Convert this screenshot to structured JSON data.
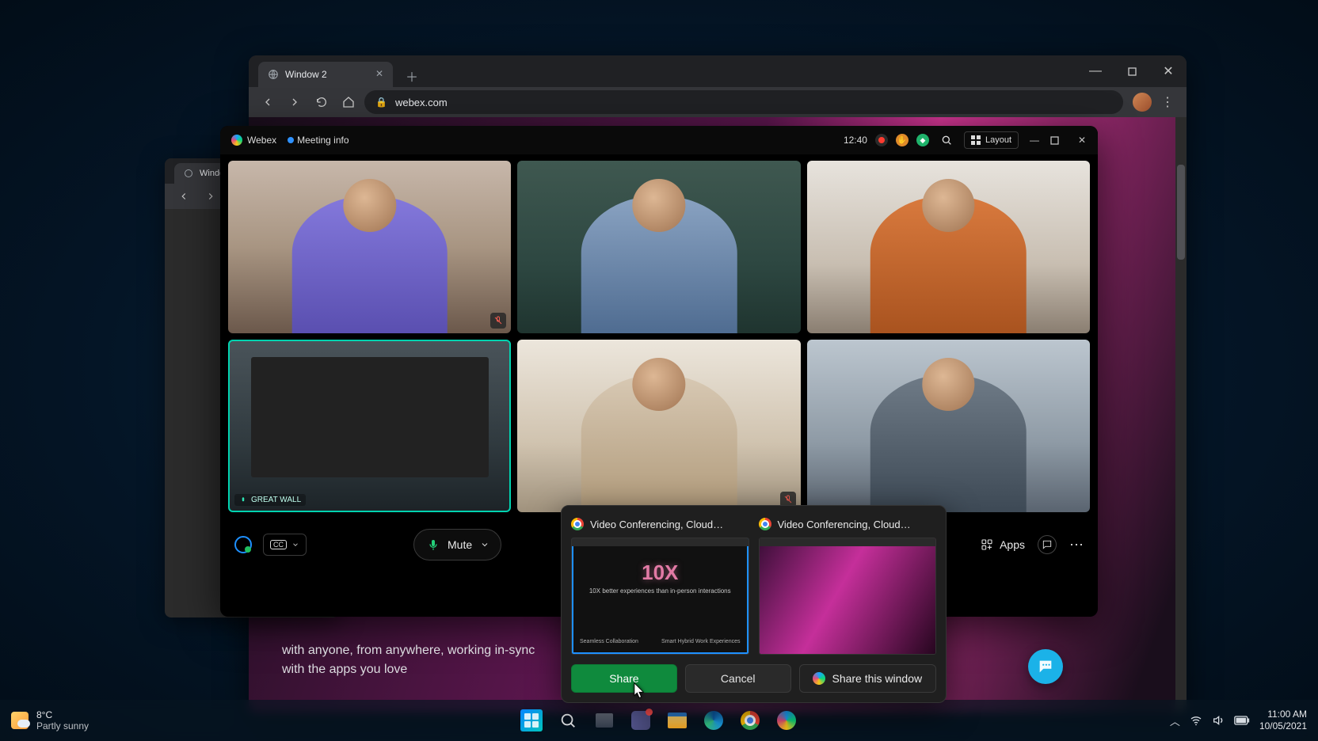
{
  "browser": {
    "tab_title": "Window 2",
    "url": "webex.com",
    "peek_tab_title": "Windo"
  },
  "webex": {
    "brand": "Webex",
    "meeting_info": "Meeting info",
    "time": "12:40",
    "layout_label": "Layout",
    "participant_label": "GREAT WALL",
    "bottom": {
      "mute_label": "Mute",
      "apps_label": "Apps"
    }
  },
  "share_popover": {
    "option1_title": "Video Conferencing, Cloud…",
    "option2_title": "Video Conferencing, Cloud…",
    "thumb": {
      "tenx": "10X",
      "sub": "10X better experiences than in-person interactions",
      "bl": "Seamless Collaboration",
      "br": "Smart Hybrid Work Experiences"
    },
    "share_label": "Share",
    "cancel_label": "Cancel",
    "share_window_label": "Share this window"
  },
  "page_text": {
    "line1": "with anyone, from anywhere, working in-sync",
    "line2": "with the apps you love"
  },
  "taskbar": {
    "temp": "8°C",
    "weather": "Partly sunny",
    "time": "11:00 AM",
    "date": "10/05/2021"
  }
}
